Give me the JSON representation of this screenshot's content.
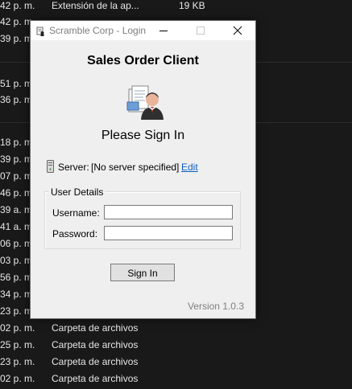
{
  "background": {
    "rows": [
      {
        "time": "42 p. m.",
        "name": "Extensión de la ap...",
        "size": "19 KB"
      },
      {
        "time": "42 p. m.",
        "name": "",
        "size": ""
      },
      {
        "time": "39 p. m.",
        "name": "",
        "size": ""
      },
      {
        "time": "51 p. m.",
        "name": "",
        "size": ""
      },
      {
        "time": "36 p. m.",
        "name": "",
        "size": ""
      },
      {
        "time": "18 p. m.",
        "name": "",
        "size": ""
      },
      {
        "time": "39 p. m.",
        "name": "",
        "size": ""
      },
      {
        "time": "07 p. m.",
        "name": "",
        "size": ""
      },
      {
        "time": "46 p. m.",
        "name": "",
        "size": ""
      },
      {
        "time": "39 a. m.",
        "name": "",
        "size": ""
      },
      {
        "time": "41 a. m.",
        "name": "",
        "size": ""
      },
      {
        "time": "06 p. m.",
        "name": "",
        "size": ""
      },
      {
        "time": "03 p. m.",
        "name": "",
        "size": ""
      },
      {
        "time": "56 p. m.",
        "name": "",
        "size": ""
      },
      {
        "time": "34 p. m.",
        "name": "",
        "size": ""
      },
      {
        "time": "23 p. m.",
        "name": "",
        "size": ""
      },
      {
        "time": "02 p. m.",
        "name": "Carpeta de archivos",
        "size": ""
      },
      {
        "time": "25 p. m.",
        "name": "Carpeta de archivos",
        "size": ""
      },
      {
        "time": "23 p. m.",
        "name": "Carpeta de archivos",
        "size": ""
      },
      {
        "time": "02 p. m.",
        "name": "Carpeta de archivos",
        "size": ""
      },
      {
        "time": "22 p. m.",
        "name": "Carpeta de archivos",
        "size": ""
      }
    ]
  },
  "dialog": {
    "title": "Scramble Corp - Login",
    "heading": "Sales Order Client",
    "subheading": "Please Sign In",
    "server_label": "Server:",
    "server_value": "[No server specified]",
    "edit_label": "Edit",
    "group_label": "User Details",
    "username_label": "Username:",
    "password_label": "Password:",
    "username_value": "",
    "password_value": "",
    "signin_label": "Sign In",
    "version": "Version 1.0.3"
  },
  "icons": {
    "title": "app-window-icon",
    "user": "user-with-documents-icon",
    "server": "server-icon"
  }
}
